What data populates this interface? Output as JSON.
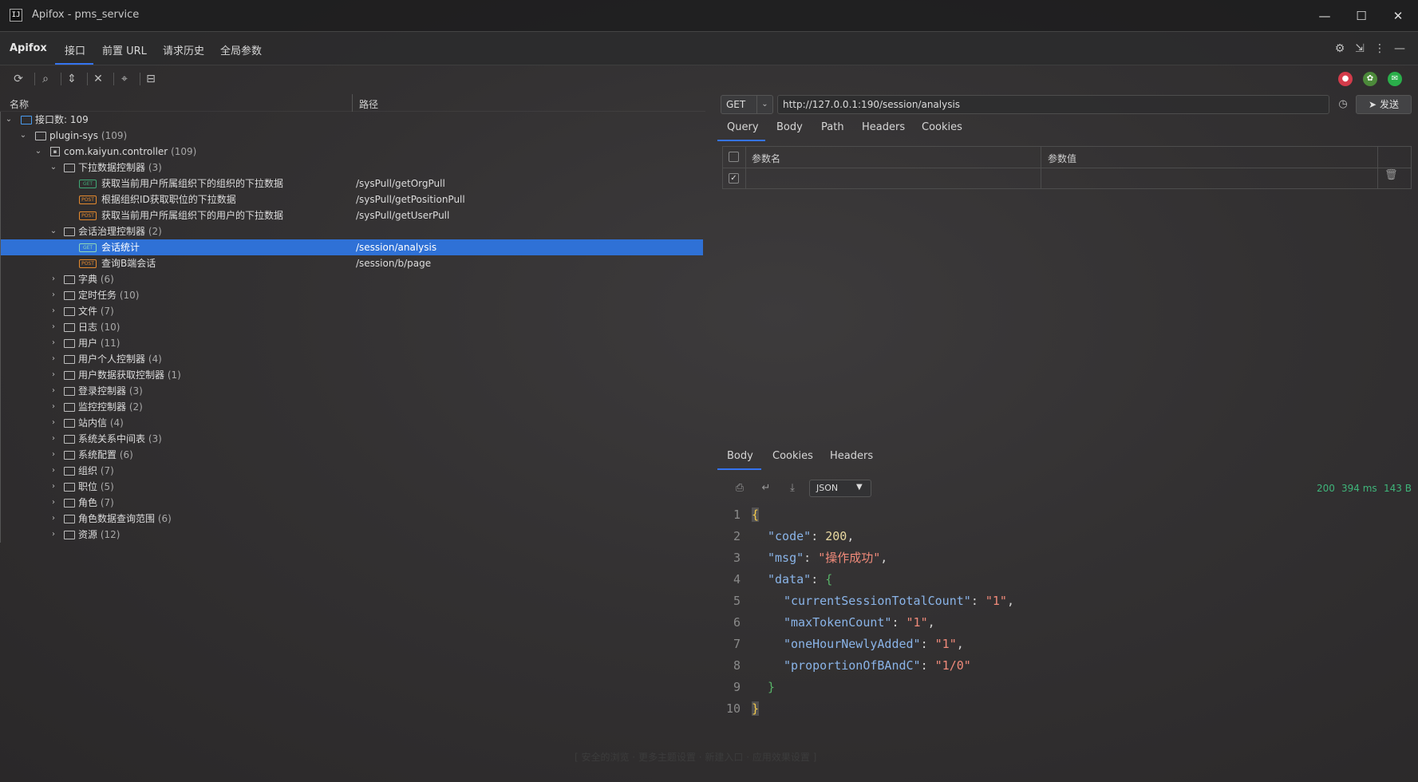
{
  "window": {
    "title": "Apifox - pms_service",
    "icon_text": "IJ",
    "minimize": "—",
    "maximize": "☐",
    "close": "✕"
  },
  "menubar": {
    "brand": "Apifox",
    "tabs": [
      "接口",
      "前置 URL",
      "请求历史",
      "全局参数"
    ],
    "active_tab": "接口"
  },
  "tree": {
    "col_name": "名称",
    "col_path": "路径",
    "root": {
      "label": "接口数:",
      "count": "109"
    },
    "module": {
      "label": "plugin-sys",
      "count": "(109)"
    },
    "package": {
      "label": "com.kaiyun.controller",
      "count": "(109)"
    },
    "group1": {
      "label": "下拉数据控制器",
      "count": "(3)"
    },
    "group1_items": [
      {
        "method": "GET",
        "label": "获取当前用户所属组织下的组织的下拉数据",
        "path": "/sysPull/getOrgPull"
      },
      {
        "method": "POST",
        "label": "根据组织ID获取职位的下拉数据",
        "path": "/sysPull/getPositionPull"
      },
      {
        "method": "POST",
        "label": "获取当前用户所属组织下的用户的下拉数据",
        "path": "/sysPull/getUserPull"
      }
    ],
    "group2": {
      "label": "会话治理控制器",
      "count": "(2)"
    },
    "group2_items": [
      {
        "method": "GET",
        "label": "会话统计",
        "path": "/session/analysis"
      },
      {
        "method": "POST",
        "label": "查询B端会话",
        "path": "/session/b/page"
      }
    ],
    "folders": [
      {
        "label": "字典",
        "count": "(6)"
      },
      {
        "label": "定时任务",
        "count": "(10)"
      },
      {
        "label": "文件",
        "count": "(7)"
      },
      {
        "label": "日志",
        "count": "(10)"
      },
      {
        "label": "用户",
        "count": "(11)"
      },
      {
        "label": "用户个人控制器",
        "count": "(4)"
      },
      {
        "label": "用户数据获取控制器",
        "count": "(1)"
      },
      {
        "label": "登录控制器",
        "count": "(3)"
      },
      {
        "label": "监控控制器",
        "count": "(2)"
      },
      {
        "label": "站内信",
        "count": "(4)"
      },
      {
        "label": "系统关系中间表",
        "count": "(3)"
      },
      {
        "label": "系统配置",
        "count": "(6)"
      },
      {
        "label": "组织",
        "count": "(7)"
      },
      {
        "label": "职位",
        "count": "(5)"
      },
      {
        "label": "角色",
        "count": "(7)"
      },
      {
        "label": "角色数据查询范围",
        "count": "(6)"
      },
      {
        "label": "资源",
        "count": "(12)"
      }
    ]
  },
  "request": {
    "method": "GET",
    "url": "http://127.0.0.1:190/session/analysis",
    "send_label": "发送",
    "tabs": [
      "Query",
      "Body",
      "Path",
      "Headers",
      "Cookies"
    ],
    "active_tab": "Query",
    "param_name_header": "参数名",
    "param_value_header": "参数值",
    "row_checked": "✓"
  },
  "response": {
    "tabs": [
      "Body",
      "Cookies",
      "Headers"
    ],
    "active_tab": "Body",
    "format": "JSON",
    "status": "200",
    "time": "394 ms",
    "size": "143 B",
    "lines": [
      {
        "n": "1",
        "text": "{"
      },
      {
        "n": "2",
        "key": "\"code\"",
        "value": "200"
      },
      {
        "n": "3",
        "key": "\"msg\"",
        "value": "\"操作成功\""
      },
      {
        "n": "4",
        "key": "\"data\"",
        "value": "{"
      },
      {
        "n": "5",
        "key": "\"currentSessionTotalCount\"",
        "value": "\"1\""
      },
      {
        "n": "6",
        "key": "\"maxTokenCount\"",
        "value": "\"1\""
      },
      {
        "n": "7",
        "key": "\"oneHourNewlyAdded\"",
        "value": "\"1\""
      },
      {
        "n": "8",
        "key": "\"proportionOfBAndC\"",
        "value": "\"1/0\""
      },
      {
        "n": "9",
        "text": "}"
      },
      {
        "n": "10",
        "text": "}"
      }
    ]
  },
  "colors": {
    "accent": "#3574f0",
    "selection": "#2f71d6",
    "get": "#3fa876",
    "post": "#e58a2e",
    "status_ok": "#3fb57a"
  },
  "icons": [
    "refresh-icon",
    "search-icon",
    "expand-all-icon",
    "collapse-all-icon",
    "locate-icon",
    "layout-icon",
    "settings-icon",
    "export-icon",
    "more-icon",
    "minimize-icon",
    "history-icon",
    "send-icon",
    "trash-icon",
    "print-icon",
    "wrap-icon",
    "download-icon"
  ],
  "footer_faint": "[ 安全的浏览 · 更多主题设置 · 新建入口 · 应用效果设置 ]"
}
